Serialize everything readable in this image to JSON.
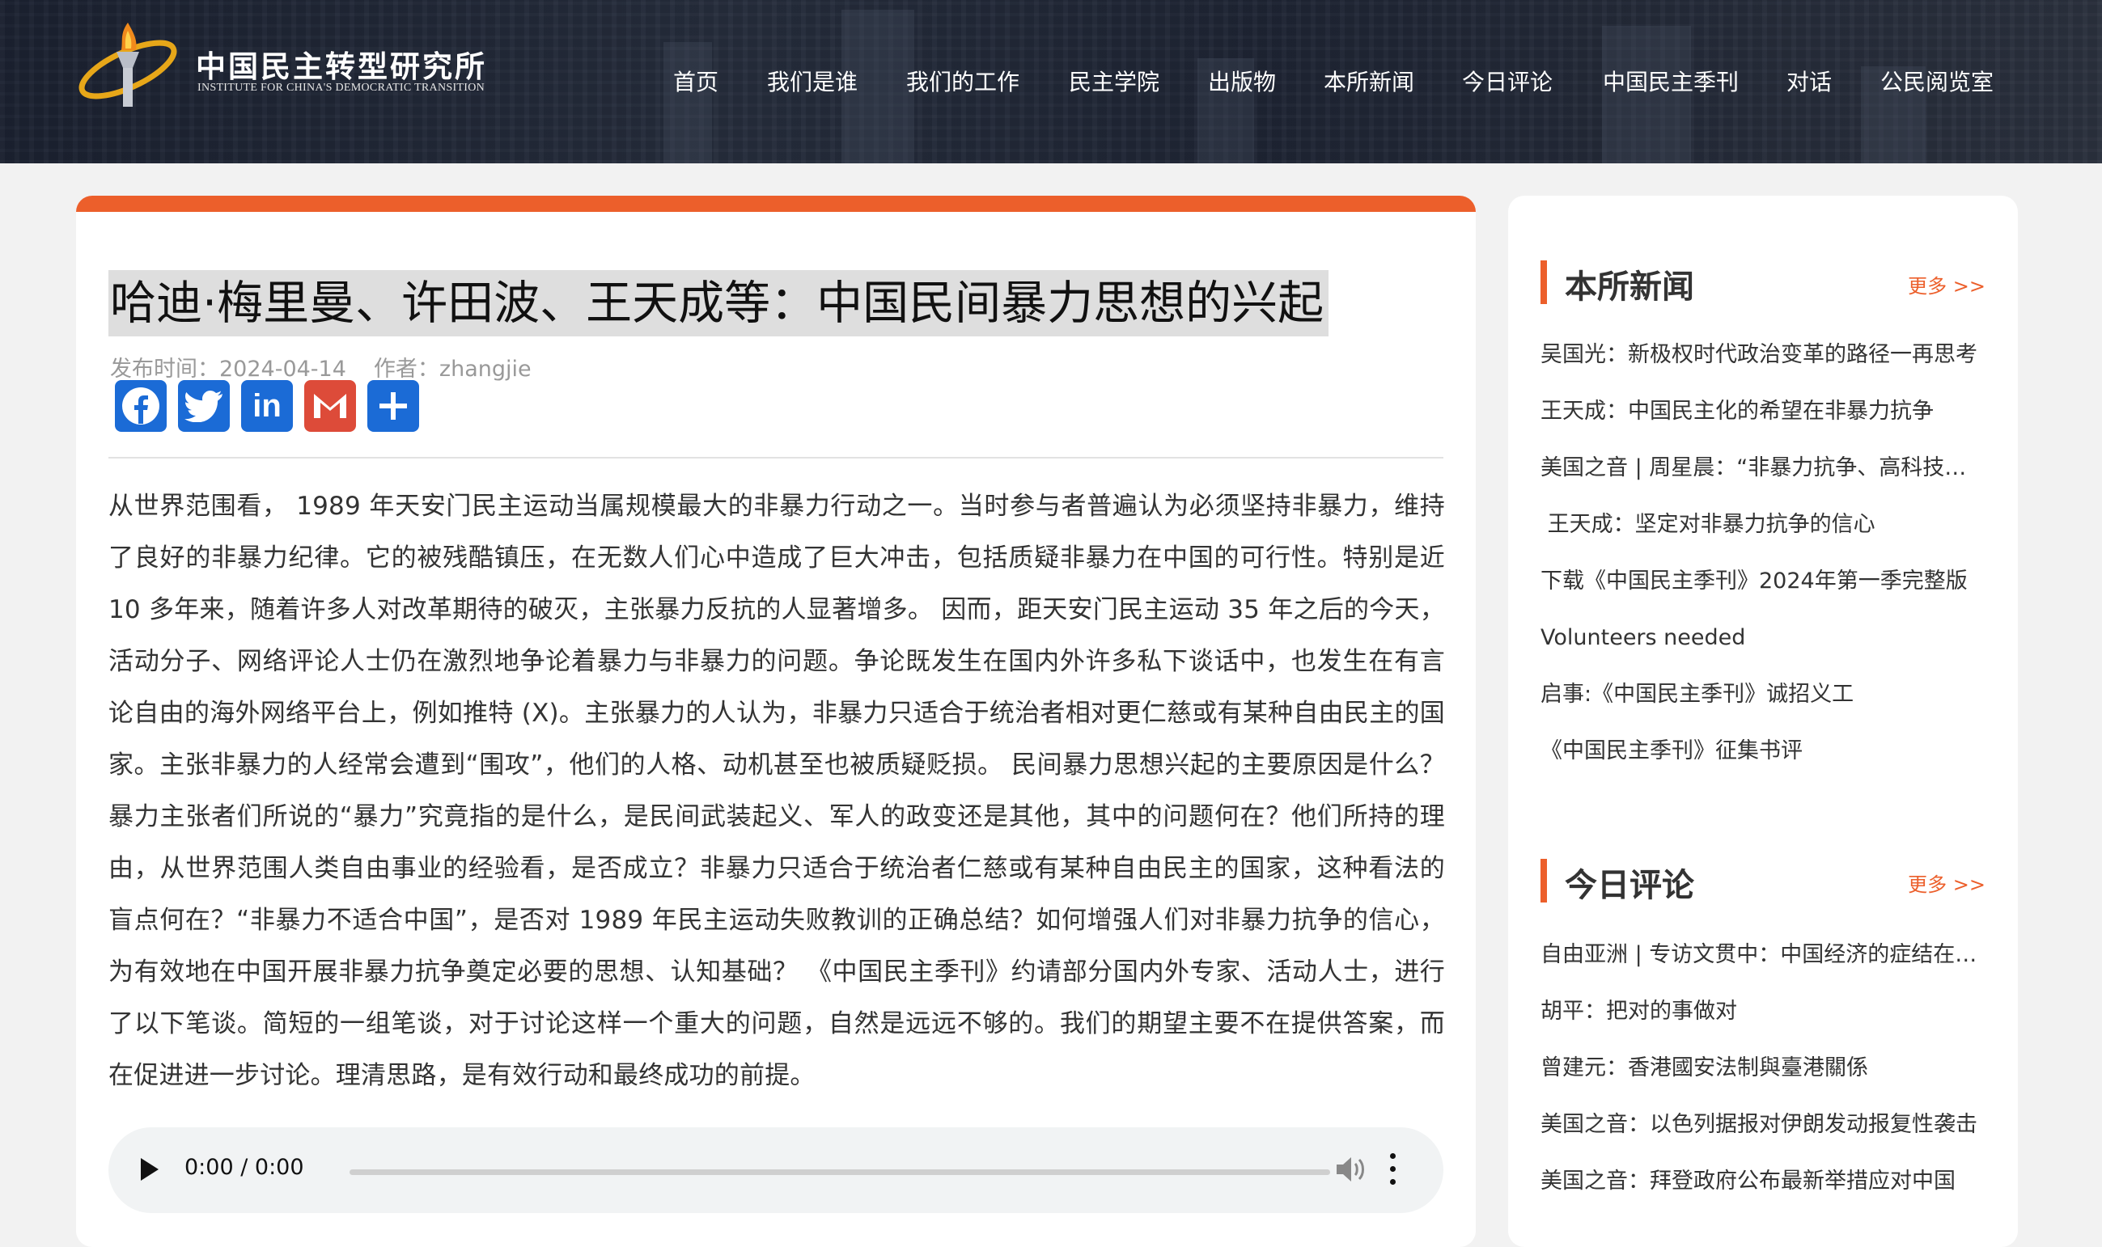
{
  "header": {
    "logo_cn": "中国民主转型研究所",
    "logo_en": "INSTITUTE FOR CHINA'S DEMOCRATIC TRANSITION",
    "nav": [
      "首页",
      "我们是谁",
      "我们的工作",
      "民主学院",
      "出版物",
      "本所新闻",
      "今日评论",
      "中国民主季刊",
      "对话",
      "公民阅览室"
    ]
  },
  "article": {
    "title": "哈迪·梅里曼、许田波、王天成等：中国民间暴力思想的兴起",
    "publish_time": "发布时间：2024-04-14",
    "author": "作者：zhangjie",
    "share_icons": [
      "facebook-icon",
      "twitter-icon",
      "linkedin-icon",
      "gmail-icon",
      "share-plus-icon"
    ],
    "body": "从世界范围看， 1989 年天安门民主运动当属规模最大的非暴力行动之一。当时参与者普遍认为必须坚持非暴力，维持了良好的非暴力纪律。它的被残酷镇压，在无数人们心中造成了巨大冲击，包括质疑非暴力在中国的可行性。特别是近 10 多年来，随着许多人对改革期待的破灭，主张暴力反抗的人显著增多。 因而，距天安门民主运动 35 年之后的今天，活动分子、网络评论人士仍在激烈地争论着暴力与非暴力的问题。争论既发生在国内外许多私下谈话中，也发生在有言论自由的海外网络平台上，例如推特 (X)。主张暴力的人认为，非暴力只适合于统治者相对更仁慈或有某种自由民主的国家。主张非暴力的人经常会遭到“围攻”，他们的人格、动机甚至也被质疑贬损。 民间暴力思想兴起的主要原因是什么？暴力主张者们所说的“暴力”究竟指的是什么，是民间武装起义、军人的政变还是其他，其中的问题何在？他们所持的理由，从世界范围人类自由事业的经验看，是否成立？非暴力只适合于统治者仁慈或有某种自由民主的国家，这种看法的盲点何在？“非暴力不适合中国”，是否对 1989 年民主运动失败教训的正确总结？如何增强人们对非暴力抗争的信心，为有效地在中国开展非暴力抗争奠定必要的思想、认知基础？ 《中国民主季刊》约请部分国内外专家、活动人士，进行了以下笔谈。简短的一组笔谈，对于讨论这样一个重大的问题，自然是远远不够的。我们的期望主要不在提供答案，而在促进进一步讨论。理清思路，是有效行动和最终成功的前提。",
    "audio_time": "0:00 / 0:00"
  },
  "sidebar": {
    "news": {
      "title": "本所新闻",
      "more": "更多 >>",
      "items": [
        "吴国光：新极权时代政治变革的路径一再思考",
        "王天成：中国民主化的希望在非暴力抗争",
        "美国之音 | 周星晨：“非暴力抗争、高科技监控”",
        " 王天成：坚定对非暴力抗争的信心",
        "下载《中国民主季刊》2024年第一季完整版",
        "Volunteers needed",
        "启事:《中国民主季刊》诚招义工",
        "《中国民主季刊》征集书评"
      ]
    },
    "commentary": {
      "title": "今日评论",
      "more": "更多 >>",
      "items": [
        "自由亚洲 | 专访文贯中：中国经济的症结在哪里",
        "胡平：把对的事做对",
        "曾建元：香港國安法制與臺港關係",
        "美国之音：以色列据报对伊朗发动报复性袭击",
        "美国之音：拜登政府公布最新举措应对中国"
      ]
    }
  },
  "colors": {
    "accent": "#ec5f2b",
    "header_bg": "#1f2533"
  }
}
